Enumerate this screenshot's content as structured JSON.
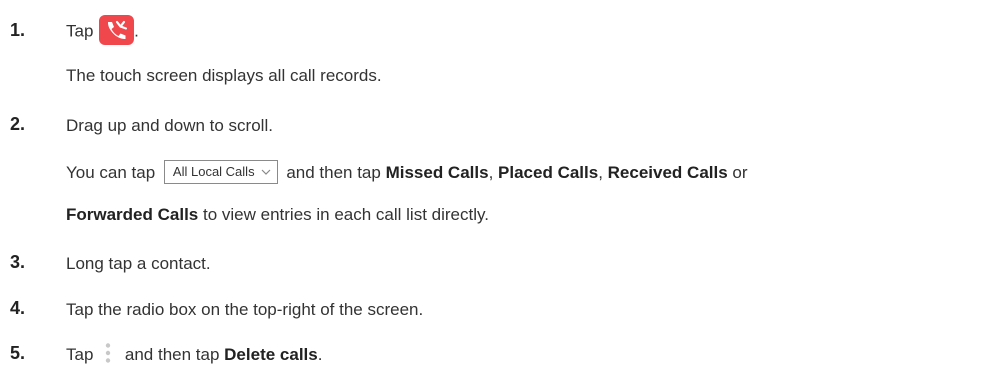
{
  "steps": [
    {
      "number": "1.",
      "lines": [
        {
          "before": "Tap ",
          "after": "."
        },
        {
          "text": "The touch screen displays all call records."
        }
      ]
    },
    {
      "number": "2.",
      "lines": [
        {
          "text": "Drag up and down to scroll."
        },
        {
          "pre": "You can tap",
          "dropdown": "All Local Calls",
          "mid": "and then tap",
          "b1": "Missed Calls",
          "c1": ", ",
          "b2": "Placed Calls",
          "c2": ", ",
          "b3": "Received Calls",
          "c3": " or"
        },
        {
          "b4": "Forwarded Calls",
          "tail": " to view entries in each call list directly."
        }
      ]
    },
    {
      "number": "3.",
      "text": "Long tap a contact."
    },
    {
      "number": "4.",
      "text": "Tap the radio box on the top-right of the screen."
    },
    {
      "number": "5.",
      "before": "Tap",
      "mid": "and then tap ",
      "bold": "Delete calls",
      "after": "."
    }
  ],
  "icons": {
    "call_history": "call-history-icon",
    "more": "more-options-icon",
    "dropdown_chevron": "chevron-down-icon"
  },
  "colors": {
    "call_icon_bg": "#f0474d"
  }
}
